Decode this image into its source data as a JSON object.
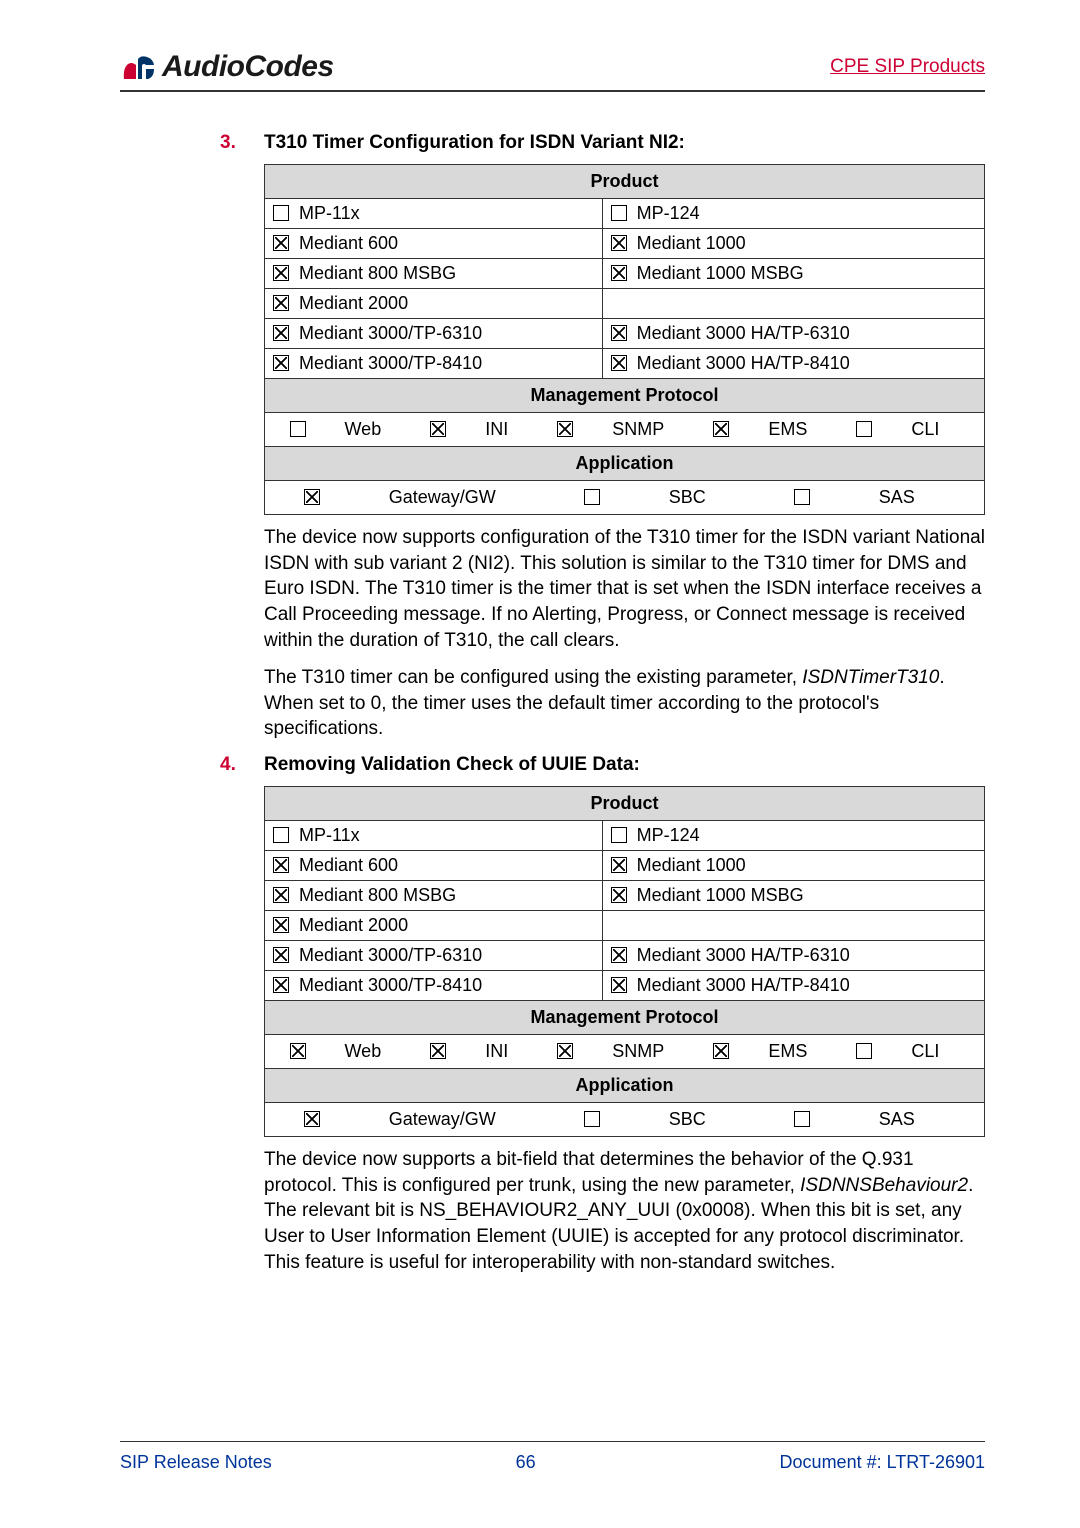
{
  "header": {
    "brand": "AudioCodes",
    "right": "CPE SIP Products"
  },
  "sections": [
    {
      "num": "3.",
      "title": "T310 Timer Configuration for ISDN Variant NI2:",
      "product": {
        "header": "Product",
        "rows": [
          [
            {
              "checked": false,
              "label": "MP-11x"
            },
            {
              "checked": false,
              "label": "MP-124"
            }
          ],
          [
            {
              "checked": true,
              "label": "Mediant 600"
            },
            {
              "checked": true,
              "label": "Mediant 1000"
            }
          ],
          [
            {
              "checked": true,
              "label": "Mediant 800 MSBG"
            },
            {
              "checked": true,
              "label": "Mediant 1000 MSBG"
            }
          ],
          [
            {
              "checked": true,
              "label": "Mediant 2000"
            },
            null
          ],
          [
            {
              "checked": true,
              "label": "Mediant 3000/TP-6310"
            },
            {
              "checked": true,
              "label": "Mediant 3000 HA/TP-6310"
            }
          ],
          [
            {
              "checked": true,
              "label": "Mediant 3000/TP-8410"
            },
            {
              "checked": true,
              "label": "Mediant 3000 HA/TP-8410"
            }
          ]
        ],
        "mp_header": "Management Protocol",
        "mp": [
          {
            "checked": false,
            "label": "Web"
          },
          {
            "checked": true,
            "label": "INI"
          },
          {
            "checked": true,
            "label": "SNMP"
          },
          {
            "checked": true,
            "label": "EMS"
          },
          {
            "checked": false,
            "label": "CLI"
          }
        ],
        "app_header": "Application",
        "app": [
          {
            "checked": true,
            "label": "Gateway/GW"
          },
          {
            "checked": false,
            "label": "SBC"
          },
          {
            "checked": false,
            "label": "SAS"
          }
        ]
      },
      "paras": [
        "The device now supports configuration of the T310 timer for the ISDN variant National ISDN with sub variant 2 (NI2). This solution is similar to the T310 timer for DMS and Euro ISDN. The T310 timer is the timer that is set when the ISDN interface receives a Call Proceeding message. If no Alerting, Progress, or Connect message is received within the duration of T310, the call clears.",
        "The T310 timer can be configured using the existing parameter, ISDNTimerT310. When set to 0, the timer uses the default timer according to the protocol's specifications."
      ],
      "italic_terms": [
        "ISDNTimerT310"
      ]
    },
    {
      "num": "4.",
      "title": "Removing Validation Check of UUIE Data:",
      "product": {
        "header": "Product",
        "rows": [
          [
            {
              "checked": false,
              "label": "MP-11x"
            },
            {
              "checked": false,
              "label": "MP-124"
            }
          ],
          [
            {
              "checked": true,
              "label": "Mediant 600"
            },
            {
              "checked": true,
              "label": "Mediant 1000"
            }
          ],
          [
            {
              "checked": true,
              "label": "Mediant 800 MSBG"
            },
            {
              "checked": true,
              "label": "Mediant 1000 MSBG"
            }
          ],
          [
            {
              "checked": true,
              "label": "Mediant 2000"
            },
            null
          ],
          [
            {
              "checked": true,
              "label": "Mediant 3000/TP-6310"
            },
            {
              "checked": true,
              "label": "Mediant 3000 HA/TP-6310"
            }
          ],
          [
            {
              "checked": true,
              "label": "Mediant 3000/TP-8410"
            },
            {
              "checked": true,
              "label": "Mediant 3000 HA/TP-8410"
            }
          ]
        ],
        "mp_header": "Management Protocol",
        "mp": [
          {
            "checked": true,
            "label": "Web"
          },
          {
            "checked": true,
            "label": "INI"
          },
          {
            "checked": true,
            "label": "SNMP"
          },
          {
            "checked": true,
            "label": "EMS"
          },
          {
            "checked": false,
            "label": "CLI"
          }
        ],
        "app_header": "Application",
        "app": [
          {
            "checked": true,
            "label": "Gateway/GW"
          },
          {
            "checked": false,
            "label": "SBC"
          },
          {
            "checked": false,
            "label": "SAS"
          }
        ]
      },
      "paras": [
        "The device now supports a bit-field that determines the behavior of the Q.931 protocol. This is configured per trunk, using the new parameter, ISDNNSBehaviour2. The relevant bit is NS_BEHAVIOUR2_ANY_UUI (0x0008). When this bit is set, any User to User Information Element (UUIE) is accepted for any protocol discriminator. This feature is useful for interoperability with non-standard switches."
      ],
      "italic_terms": [
        "ISDNNSBehaviour2"
      ]
    }
  ],
  "footer": {
    "left": "SIP Release Notes",
    "center": "66",
    "right": "Document #: LTRT-26901"
  }
}
